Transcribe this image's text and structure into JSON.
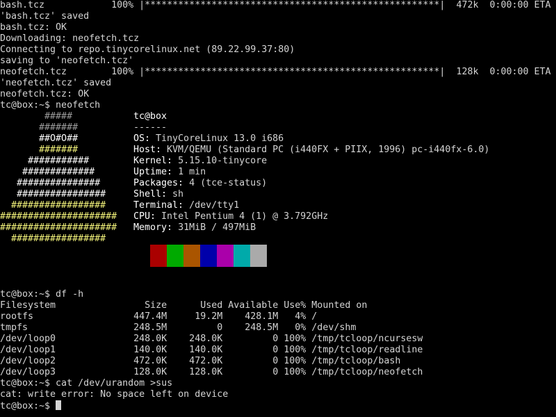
{
  "top_lines": [
    "bash.tcz            100% |*****************************************************|  472k  0:00:00 ETA",
    "'bash.tcz' saved",
    "bash.tcz: OK",
    "Downloading: neofetch.tcz",
    "Connecting to repo.tinycorelinux.net (89.22.99.37:80)",
    "saving to 'neofetch.tcz'",
    "neofetch.tcz        100% |*****************************************************|  128k  0:00:00 ETA",
    "'neofetch.tcz' saved",
    "neofetch.tcz: OK",
    "tc@box:~$ neofetch"
  ],
  "neofetch": {
    "logo": [
      "        #####",
      "       #######",
      "       ##O#O##",
      "       #######",
      "     ###########",
      "    #############",
      "   ###############",
      "   ################",
      "  #################",
      "#####################",
      "#####################",
      "  #################"
    ],
    "user_host": "tc@box",
    "separator": "------",
    "os_label": "OS",
    "os_value": "TinyCoreLinux 13.0 i686",
    "host_label": "Host",
    "host_value": "KVM/QEMU (Standard PC (i440FX + PIIX, 1996) pc-i440fx-6.0)",
    "kernel_label": "Kernel",
    "kernel_value": "5.15.10-tinycore",
    "uptime_label": "Uptime",
    "uptime_value": "1 min",
    "packages_label": "Packages",
    "packages_value": "4 (tce-status)",
    "shell_label": "Shell",
    "shell_value": "sh",
    "terminal_label": "Terminal",
    "terminal_value": "/dev/tty1",
    "cpu_label": "CPU",
    "cpu_value": "Intel Pentium 4 (1) @ 3.792GHz",
    "memory_label": "Memory",
    "memory_value": "31MiB / 497MiB",
    "palette": [
      "#000000",
      "#aa0000",
      "#00aa00",
      "#aa5500",
      "#0000aa",
      "#aa00aa",
      "#00aaaa",
      "#aaaaaa"
    ]
  },
  "df": {
    "command": "tc@box:~$ df -h",
    "header": "Filesystem                Size      Used Available Use% Mounted on",
    "rows": [
      "rootfs                  447.4M     19.2M    428.1M   4% /",
      "tmpfs                   248.5M         0    248.5M   0% /dev/shm",
      "/dev/loop0              248.0K    248.0K         0 100% /tmp/tcloop/ncursesw",
      "/dev/loop1              140.0K    140.0K         0 100% /tmp/tcloop/readline",
      "/dev/loop2              472.0K    472.0K         0 100% /tmp/tcloop/bash",
      "/dev/loop3              128.0K    128.0K         0 100% /tmp/tcloop/neofetch"
    ]
  },
  "bottom_lines": [
    "tc@box:~$ cat /dev/urandom >sus",
    "cat: write error: No space left on device",
    "tc@box:~$ "
  ]
}
